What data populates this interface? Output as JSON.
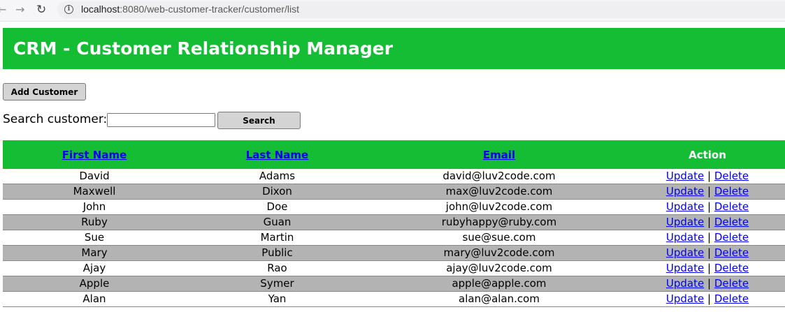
{
  "browser": {
    "url_host": "localhost",
    "url_rest": ":8080/web-customer-tracker/customer/list"
  },
  "header": {
    "title": "CRM - Customer Relationship Manager"
  },
  "actions": {
    "add_label": "Add Customer"
  },
  "search": {
    "label": "Search customer:",
    "value": "",
    "button_label": "Search"
  },
  "table": {
    "columns": [
      "First Name",
      "Last Name",
      "Email",
      "Action"
    ],
    "update_label": "Update",
    "delete_label": "Delete",
    "separator": "|",
    "rows": [
      {
        "first": "David",
        "last": "Adams",
        "email": "david@luv2code.com"
      },
      {
        "first": "Maxwell",
        "last": "Dixon",
        "email": "max@luv2code.com"
      },
      {
        "first": "John",
        "last": "Doe",
        "email": "john@luv2code.com"
      },
      {
        "first": "Ruby",
        "last": "Guan",
        "email": "rubyhappy@ruby.com"
      },
      {
        "first": "Sue",
        "last": "Martin",
        "email": "sue@sue.com"
      },
      {
        "first": "Mary",
        "last": "Public",
        "email": "mary@luv2code.com"
      },
      {
        "first": "Ajay",
        "last": "Rao",
        "email": "ajay@luv2code.com"
      },
      {
        "first": "Apple",
        "last": "Symer",
        "email": "apple@apple.com"
      },
      {
        "first": "Alan",
        "last": "Yan",
        "email": "alan@alan.com"
      }
    ]
  },
  "colors": {
    "accent_green": "#15bd35",
    "row_alt": "#b3b3b3",
    "link": "#0000ee"
  }
}
